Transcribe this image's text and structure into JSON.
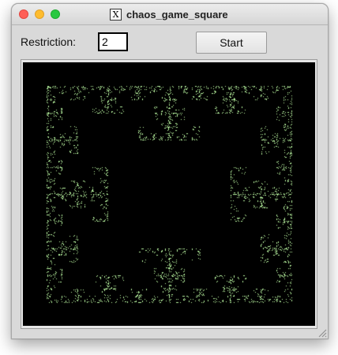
{
  "window": {
    "title": "chaos_game_square",
    "app_icon": "x11-icon"
  },
  "controls": {
    "restriction_label": "Restriction:",
    "restriction_value": "2",
    "start_label": "Start"
  },
  "canvas": {
    "background": "#000000",
    "point_color": "#b8f5a0",
    "description_type": "chaos-game fractal (square vertices, restriction 2)"
  },
  "colors": {
    "window_bg": "#d9d9d9",
    "close": "#fe5f57",
    "minimize": "#febc2e",
    "maximize": "#28c840"
  }
}
